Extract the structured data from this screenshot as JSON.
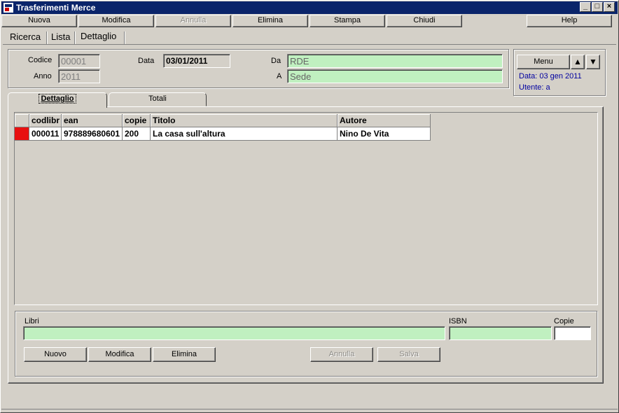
{
  "window": {
    "title": "Trasferimenti Merce"
  },
  "menu": {
    "nuova": "Nuova",
    "modifica": "Modifica",
    "annulla": "Annulla",
    "elimina": "Elimina",
    "stampa": "Stampa",
    "chiudi": "Chiudi",
    "help": "Help"
  },
  "top_tabs": [
    "Ricerca",
    "Lista",
    "Dettaglio"
  ],
  "header": {
    "codice_label": "Codice",
    "codice_value": "00001",
    "anno_label": "Anno",
    "anno_value": "2011",
    "data_label": "Data",
    "data_value": "03/01/2011",
    "da_label": "Da",
    "da_value": "RDE",
    "a_label": "A",
    "a_value": "Sede"
  },
  "side_panel": {
    "menu_label": "Menu",
    "date_info": "Data: 03 gen 2011",
    "user_info": "Utente: a"
  },
  "inner_tabs": [
    "Dettaglio",
    "Totali"
  ],
  "grid": {
    "columns": [
      "codlibr",
      "ean",
      "copie",
      "Titolo",
      "Autore"
    ],
    "rows": [
      [
        "000011",
        "978889680601",
        "200",
        "La casa sull'altura",
        "Nino De Vita"
      ]
    ]
  },
  "form": {
    "libri_label": "Libri",
    "libri_value": "",
    "isbn_label": "ISBN",
    "isbn_value": "",
    "copie_label": "Copie",
    "copie_value": ""
  },
  "actions": {
    "nuovo": "Nuovo",
    "modifica": "Modifica",
    "elimina": "Elimina",
    "annulla": "Annulla",
    "salva": "Salva"
  },
  "colors": {
    "titlebar": "#0a246a",
    "field_green": "#c0f0c0",
    "indicator_red": "#e81010",
    "info_blue": "#0000a0"
  }
}
